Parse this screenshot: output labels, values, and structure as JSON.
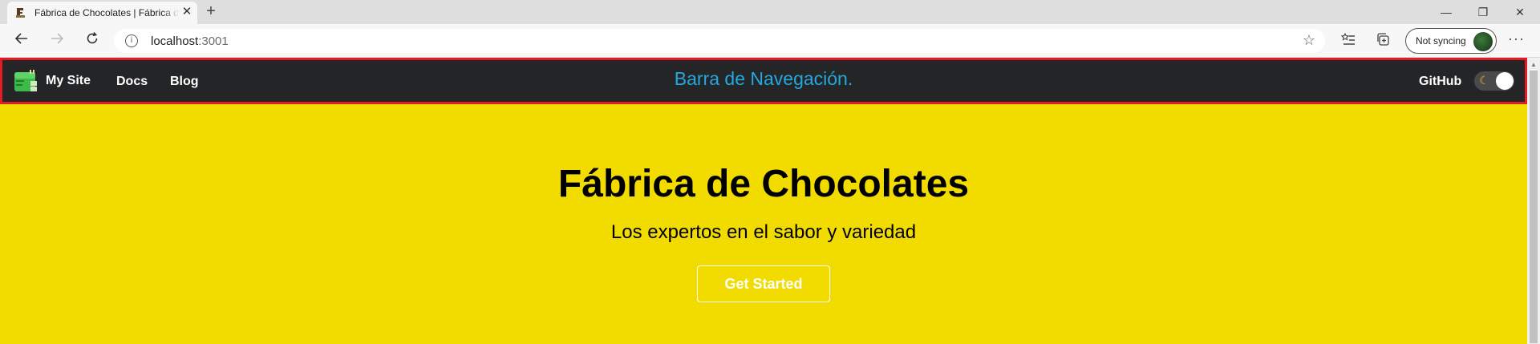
{
  "browser": {
    "tab": {
      "title": "Fábrica de Chocolates | Fábrica de Chocolates",
      "close_glyph": "✕",
      "favicon": "dinosaur-icon"
    },
    "new_tab_glyph": "+",
    "window_controls": {
      "minimize": "—",
      "restore": "❐",
      "close": "✕"
    },
    "url_host": "localhost",
    "url_port": ":3001",
    "sync_label": "Not syncing",
    "more_glyph": "···"
  },
  "site": {
    "brand": "My Site",
    "nav_links": [
      "Docs",
      "Blog"
    ],
    "nav_center": "Barra de Navegación.",
    "github": "GitHub",
    "theme_toggle": {
      "state": "light",
      "icon": "moon-icon"
    },
    "colors": {
      "navbar_bg": "#242526",
      "navbar_outline": "#e21b24",
      "nav_center_text": "#25a8e0",
      "hero_bg": "#f2dc00"
    }
  },
  "hero": {
    "title": "Fábrica de Chocolates",
    "subtitle": "Los expertos en el sabor y variedad",
    "cta": "Get Started"
  }
}
